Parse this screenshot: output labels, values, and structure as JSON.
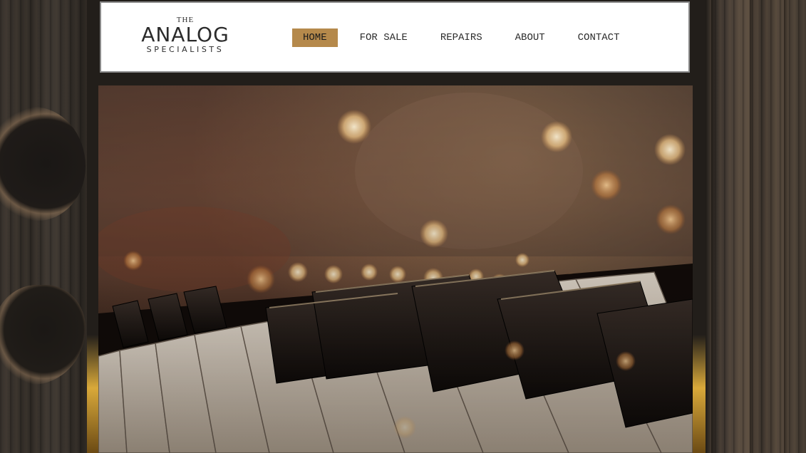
{
  "site": {
    "logo": {
      "the": "THE",
      "name": "ANALOG",
      "tagline": "SPECIALISTS"
    },
    "nav": {
      "active_index": 0,
      "items": [
        {
          "label": "HOME",
          "active": true
        },
        {
          "label": "FOR SALE",
          "active": false
        },
        {
          "label": "REPAIRS",
          "active": false
        },
        {
          "label": "ABOUT",
          "active": false
        },
        {
          "label": "CONTACT",
          "active": false
        }
      ]
    },
    "hero": {
      "image_subject": "piano keys with bokeh lights"
    },
    "colors": {
      "accent": "#b5894b",
      "header_bg": "#ffffff",
      "nav_text": "#2b2b2b",
      "frame_bg": "#221e1a"
    }
  }
}
